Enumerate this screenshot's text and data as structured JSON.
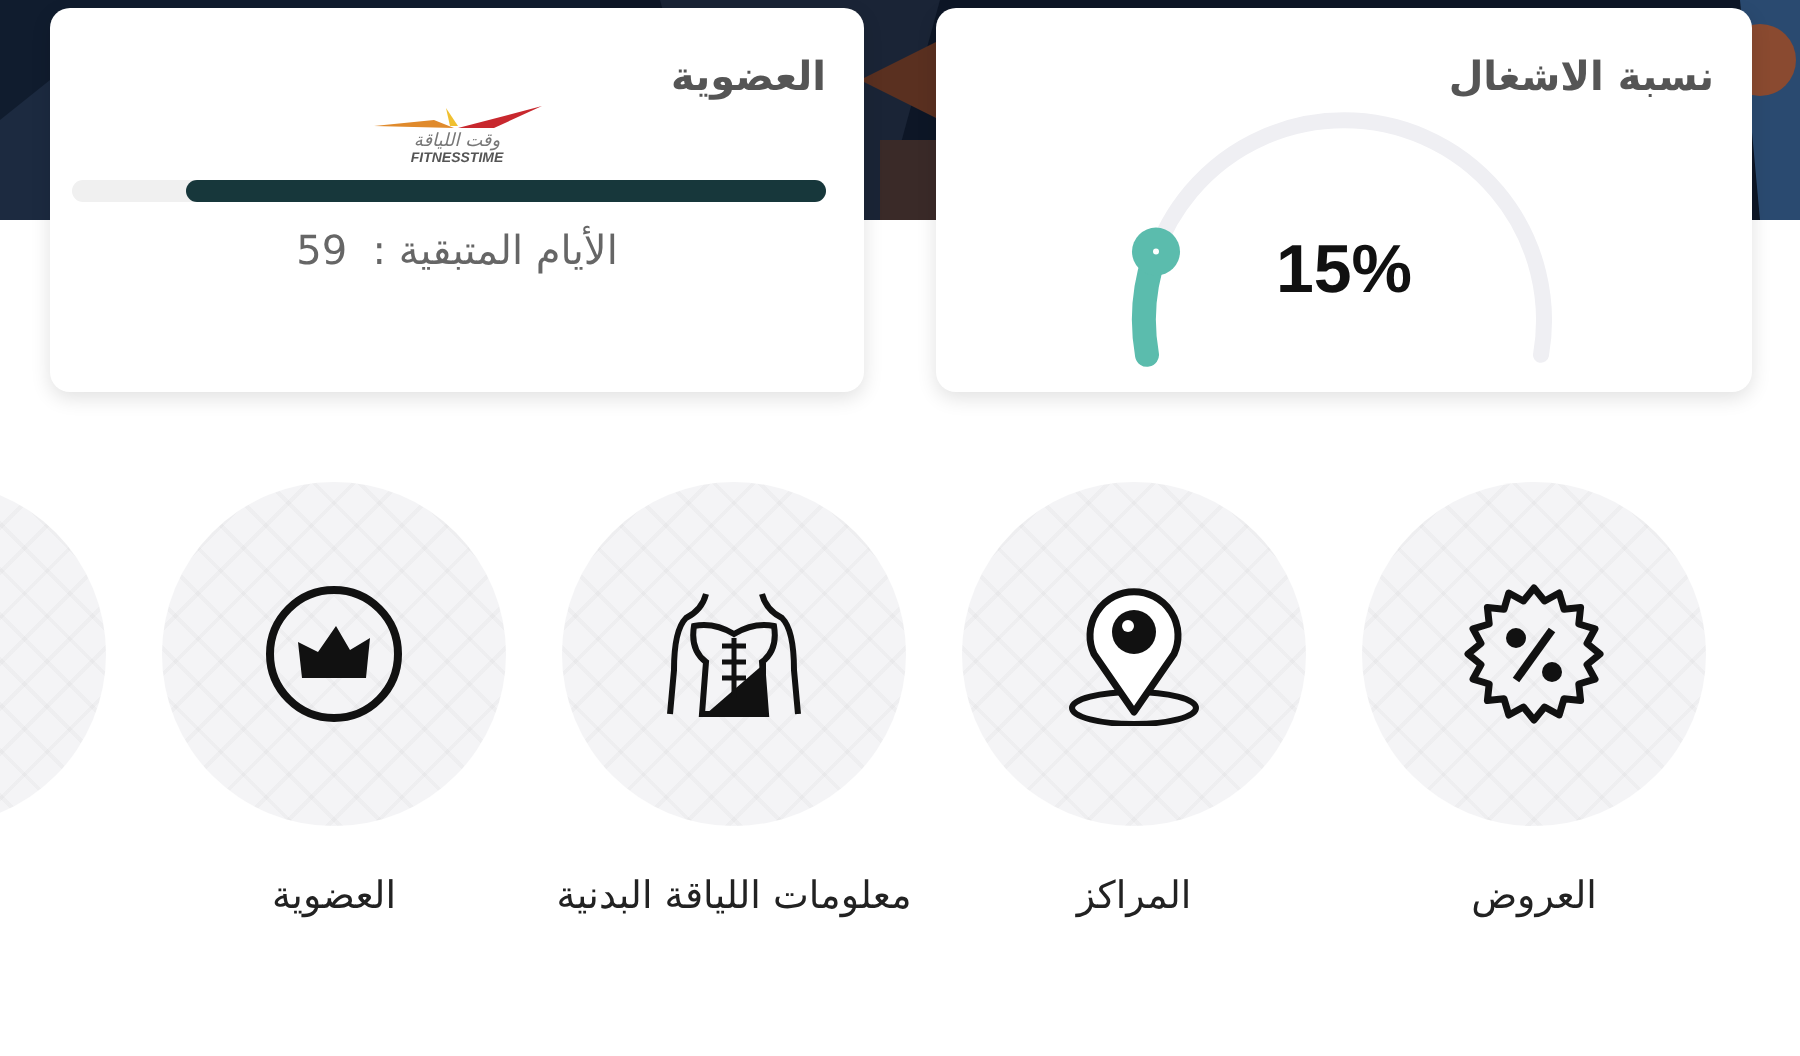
{
  "occupancy": {
    "title": "نسبة الاشغال",
    "value": "15%",
    "level": 0.15
  },
  "membership": {
    "title": "العضوية",
    "logo_ar": "وقت اللياقة",
    "logo_en": "FITNESSTIME",
    "level": 0.85,
    "remaining": "الأيام المتبقية :  59"
  },
  "services": [
    {
      "kind": "offers",
      "label": "العروض"
    },
    {
      "kind": "centers",
      "label": "المراكز"
    },
    {
      "kind": "fitness",
      "label": "معلومات اللياقة البدنية"
    },
    {
      "kind": "membership",
      "label": "العضوية"
    },
    {
      "kind": "blank"
    }
  ]
}
